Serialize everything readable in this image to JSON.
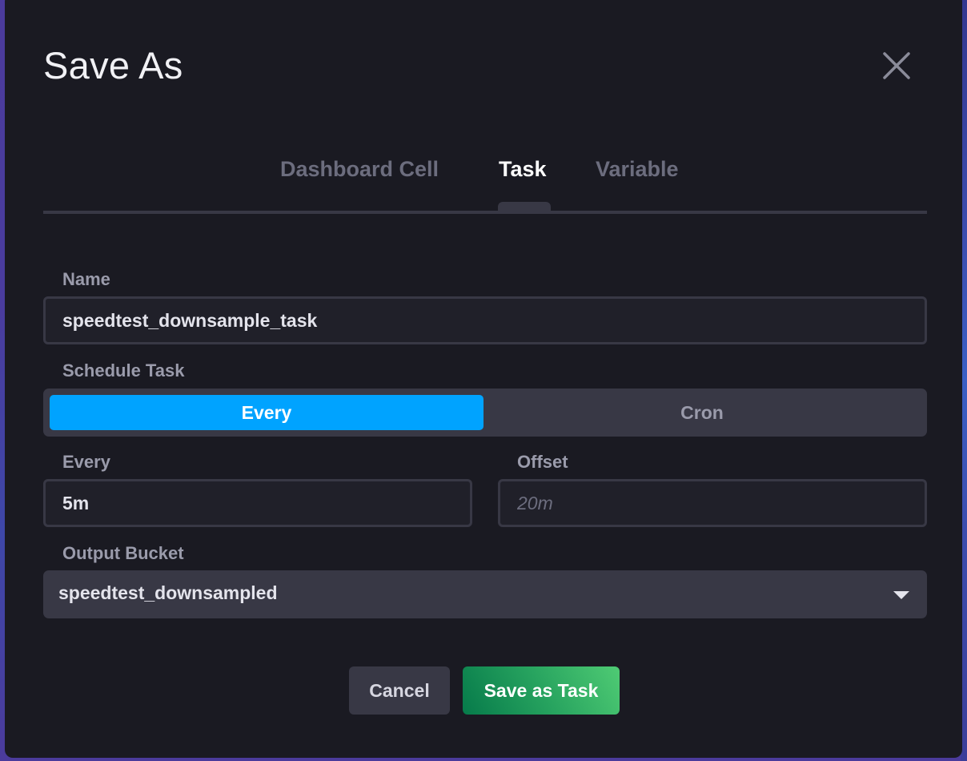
{
  "dialog": {
    "title": "Save As",
    "close_icon": "close-icon"
  },
  "tabs": [
    {
      "label": "Dashboard Cell",
      "active": false
    },
    {
      "label": "Task",
      "active": true
    },
    {
      "label": "Variable",
      "active": false
    }
  ],
  "form": {
    "name": {
      "label": "Name",
      "value": "speedtest_downsample_task"
    },
    "schedule": {
      "label": "Schedule Task",
      "options": [
        "Every",
        "Cron"
      ],
      "selected": "Every"
    },
    "every": {
      "label": "Every",
      "value": "5m"
    },
    "offset": {
      "label": "Offset",
      "value": "",
      "placeholder": "20m"
    },
    "output_bucket": {
      "label": "Output Bucket",
      "selected": "speedtest_downsampled"
    }
  },
  "footer": {
    "cancel_label": "Cancel",
    "save_label": "Save as Task"
  },
  "colors": {
    "accent_blue": "#00a3ff",
    "save_green_start": "#067a4a",
    "save_green_end": "#4fcb74",
    "dialog_bg": "#1a1a22"
  }
}
